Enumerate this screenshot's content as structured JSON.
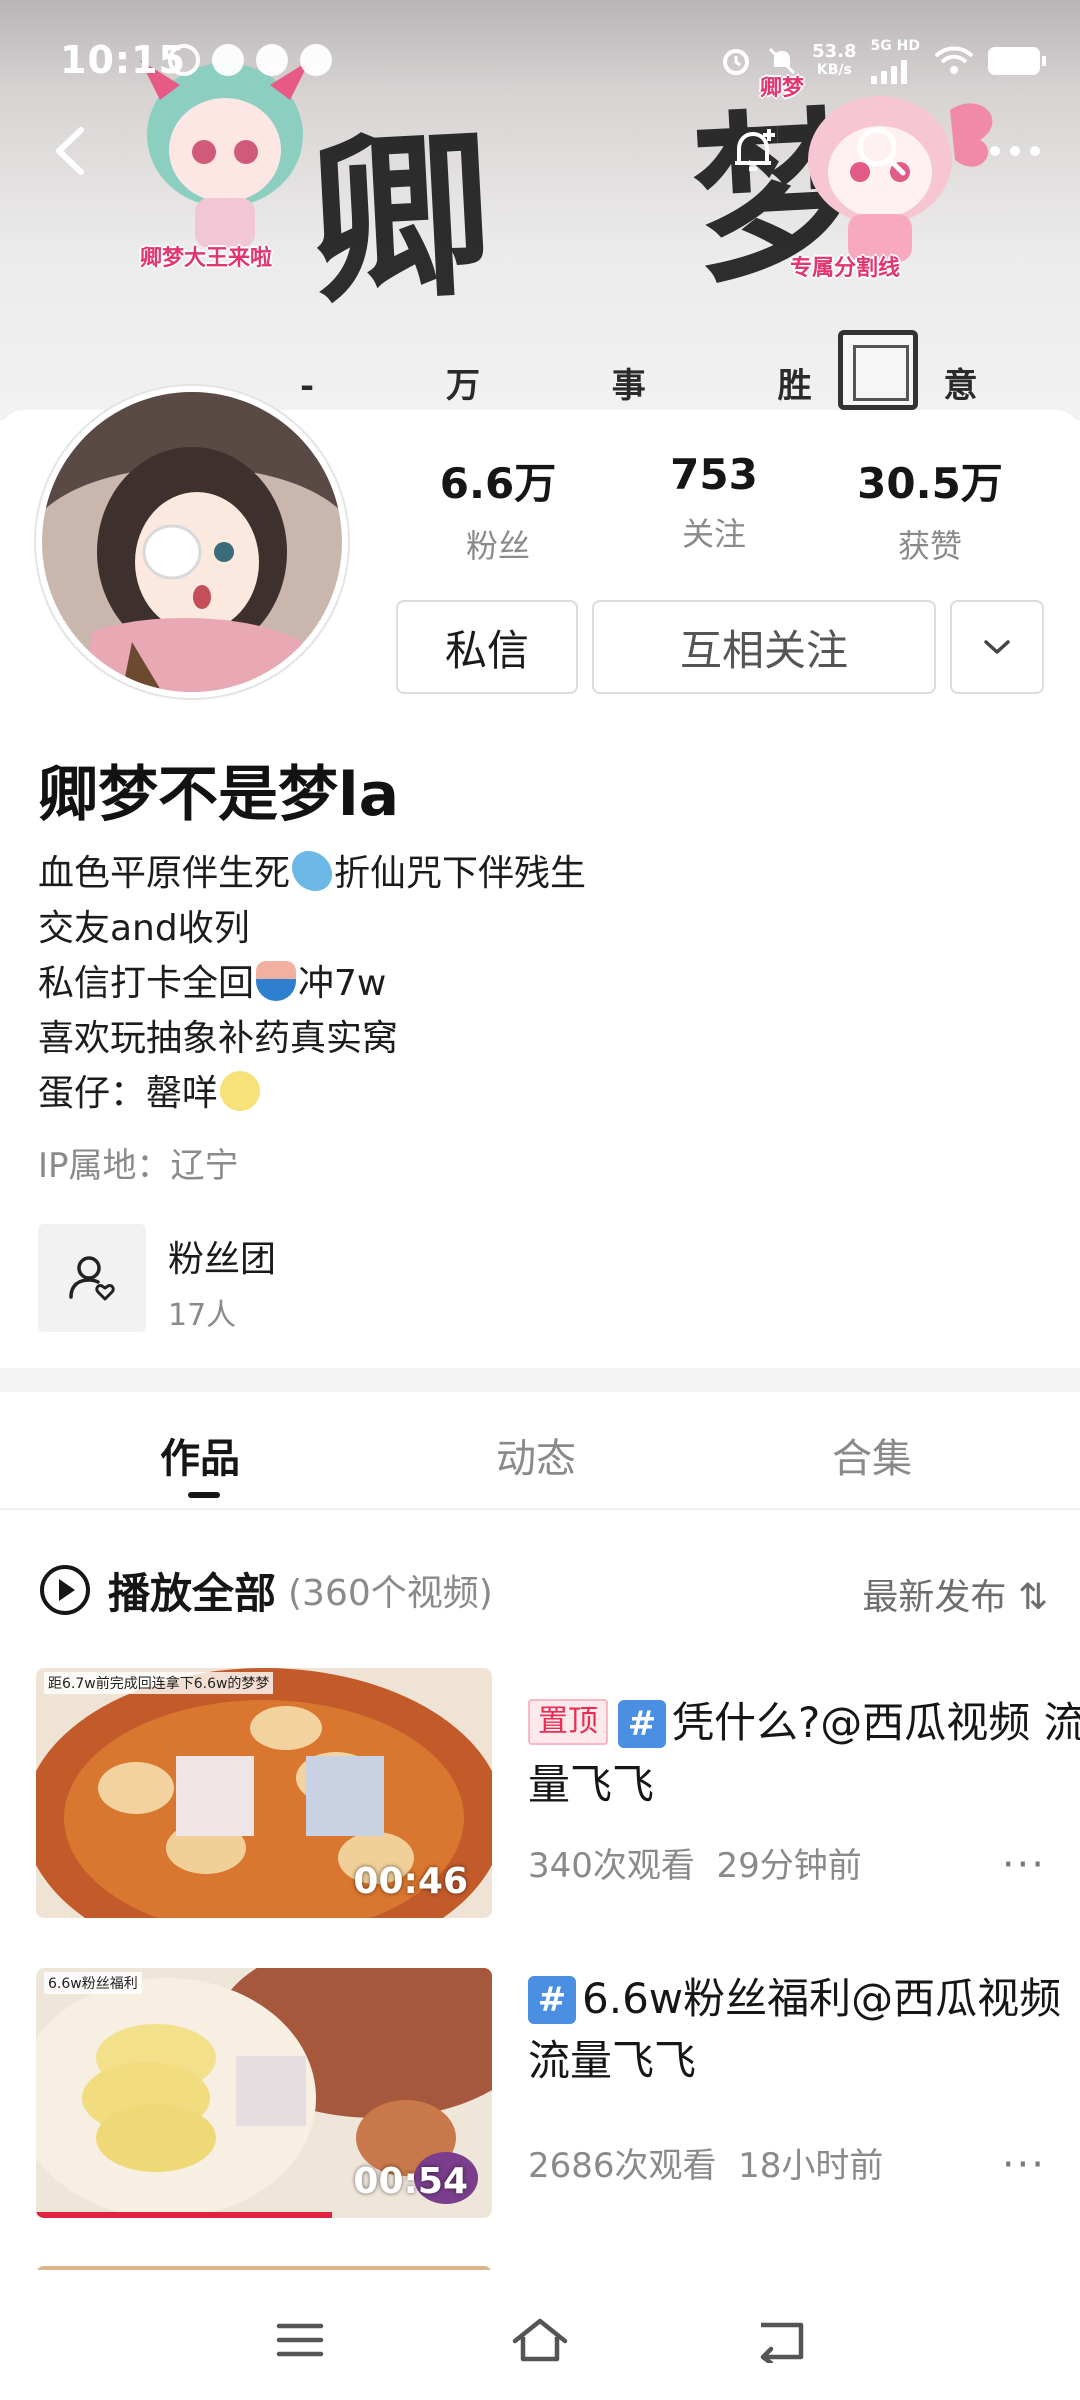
{
  "status_bar": {
    "time": "10:15",
    "net_speed_value": "53.8",
    "net_speed_unit": "KB/s",
    "network_type": "5G HD"
  },
  "banner": {
    "title": "卿 梦",
    "subtitle": "- 万 事 胜 意 -",
    "sticker_left_caption": "卿梦大王来啦",
    "sticker_right_label": "卿梦",
    "sticker_right_caption": "专属分割线"
  },
  "profile": {
    "stats": [
      {
        "value": "6.6万",
        "label": "粉丝"
      },
      {
        "value": "753",
        "label": "关注"
      },
      {
        "value": "30.5万",
        "label": "获赞"
      }
    ],
    "message_button": "私信",
    "follow_button": "互相关注",
    "name": "卿梦不是梦la",
    "bio_lines": {
      "line1a": "血色平原伴生死",
      "line1b": "折仙咒下伴残生",
      "line2": "交友and收列",
      "line3a": "私信打卡全回",
      "line3b": "冲7w",
      "line4": "喜欢玩抽象补药真实窝",
      "line5": "蛋仔：罄咩"
    },
    "ip_location": "IP属地：辽宁",
    "fan_group": {
      "title": "粉丝团",
      "count": "17人"
    }
  },
  "tabs": [
    "作品",
    "动态",
    "合集"
  ],
  "play_all": {
    "label": "播放全部",
    "count": "(360个视频)",
    "sort": "最新发布 ⇅"
  },
  "videos": [
    {
      "pinned_label": "置顶",
      "title": "凭什么?@西瓜视频 流量飞飞",
      "views": "340次观看",
      "time": "29分钟前",
      "duration": "00:46",
      "thumb_caption": "距6.7w前完成回连拿下6.6w的梦梦"
    },
    {
      "title": "6.6w粉丝福利@西瓜视频 流量飞飞",
      "views": "2686次观看",
      "time": "18小时前",
      "duration": "00:54",
      "thumb_caption": "6.6w粉丝福利"
    }
  ],
  "colors": {
    "pin_red": "#ea2b52",
    "hashtag_blue": "#4a8fe2",
    "muted_text": "#8a8a8a",
    "progress_red": "#e02440"
  }
}
